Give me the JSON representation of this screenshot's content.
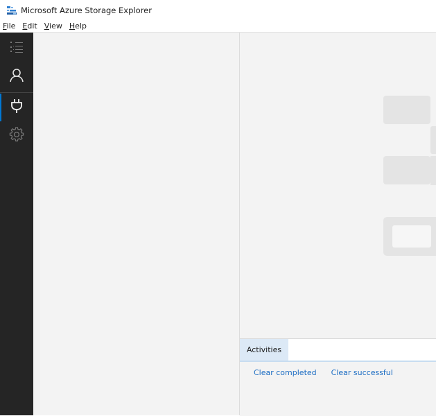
{
  "window": {
    "title": "Microsoft Azure Storage Explorer"
  },
  "menu": {
    "items": [
      {
        "accel": "F",
        "rest": "ile"
      },
      {
        "accel": "E",
        "rest": "dit"
      },
      {
        "accel": "V",
        "rest": "iew"
      },
      {
        "accel": "H",
        "rest": "elp"
      }
    ]
  },
  "activity_bar": {
    "items": [
      {
        "icon": "explorer-icon",
        "active": false
      },
      {
        "icon": "account-icon",
        "active": false
      },
      {
        "icon": "plug-icon",
        "active": true
      },
      {
        "icon": "gear-icon",
        "active": false
      }
    ]
  },
  "activities_panel": {
    "tab_label": "Activities",
    "clear_completed": "Clear completed",
    "clear_successful": "Clear successful"
  },
  "colors": {
    "accent": "#0078d4",
    "link": "#1c6dc3",
    "activity_bar_bg": "#252525"
  }
}
